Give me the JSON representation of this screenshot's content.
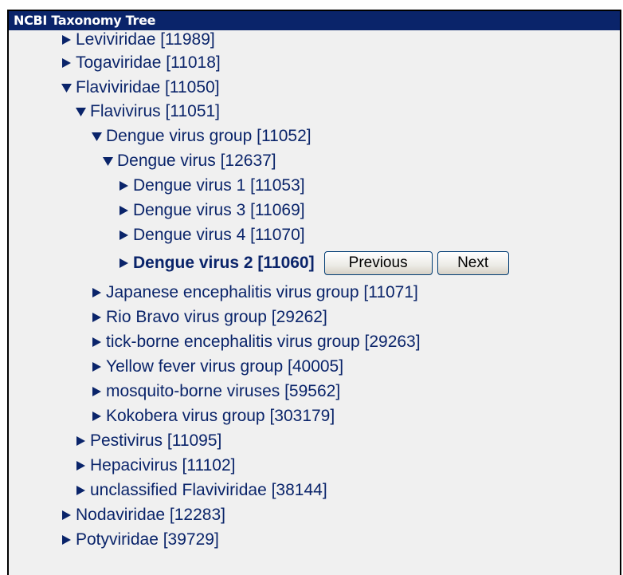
{
  "panel": {
    "title": "NCBI Taxonomy Tree"
  },
  "tree": {
    "nodes": [
      {
        "label": "Leviviridae [11989]",
        "state": "collapsed"
      },
      {
        "label": "Togaviridae [11018]",
        "state": "collapsed"
      },
      {
        "label": "Flaviviridae [11050]",
        "state": "expanded"
      },
      {
        "label": "Flavivirus [11051]",
        "state": "expanded"
      },
      {
        "label": "Dengue virus group [11052]",
        "state": "expanded"
      },
      {
        "label": "Dengue virus [12637]",
        "state": "expanded"
      },
      {
        "label": "Dengue virus 1 [11053]",
        "state": "collapsed"
      },
      {
        "label": "Dengue virus 3 [11069]",
        "state": "collapsed"
      },
      {
        "label": "Dengue virus 4 [11070]",
        "state": "collapsed"
      },
      {
        "label": "Dengue virus 2 [11060]",
        "state": "collapsed",
        "current": true
      },
      {
        "label": "Japanese encephalitis virus group [11071]",
        "state": "collapsed"
      },
      {
        "label": "Rio Bravo virus group [29262]",
        "state": "collapsed"
      },
      {
        "label": "tick-borne encephalitis virus group [29263]",
        "state": "collapsed"
      },
      {
        "label": "Yellow fever virus group [40005]",
        "state": "collapsed"
      },
      {
        "label": "mosquito-borne viruses [59562]",
        "state": "collapsed"
      },
      {
        "label": "Kokobera virus group [303179]",
        "state": "collapsed"
      },
      {
        "label": "Pestivirus [11095]",
        "state": "collapsed"
      },
      {
        "label": "Hepacivirus [11102]",
        "state": "collapsed"
      },
      {
        "label": "unclassified Flaviviridae [38144]",
        "state": "collapsed"
      },
      {
        "label": "Nodaviridae [12283]",
        "state": "collapsed"
      },
      {
        "label": "Potyviridae [39729]",
        "state": "collapsed"
      }
    ]
  },
  "nav": {
    "previous_label": "Previous",
    "next_label": "Next"
  },
  "colors": {
    "title_bar": "#0a246a",
    "title_text": "#ffffff",
    "tree_text": "#0a246a",
    "panel_bg": "#f0f0f0"
  }
}
